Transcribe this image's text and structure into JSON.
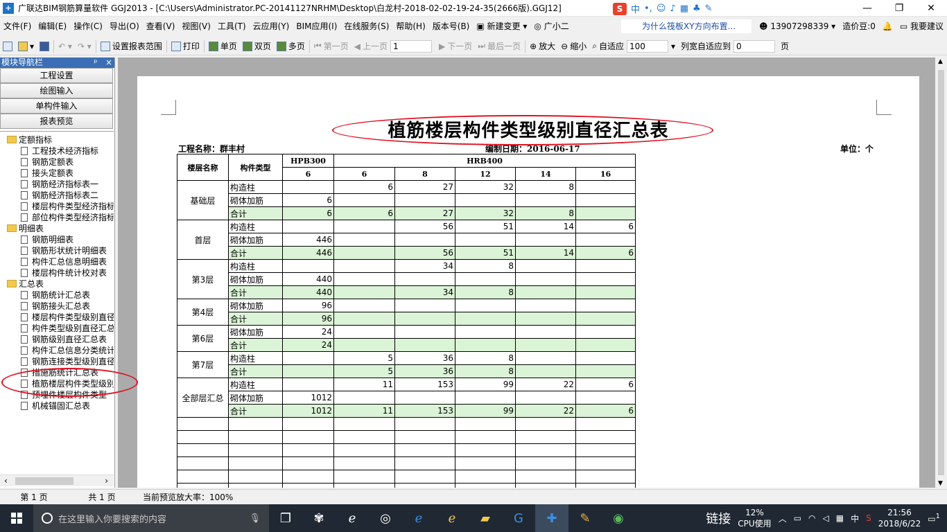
{
  "window": {
    "title": "广联达BIM钢筋算量软件 GGJ2013 - [C:\\Users\\Administrator.PC-20141127NRHM\\Desktop\\白龙村-2018-02-02-19-24-35(2666版).GGJ12]",
    "app_icon": "+",
    "ime": {
      "logo": "S",
      "mode": "中"
    }
  },
  "menu": {
    "items": [
      "文件(F)",
      "编辑(E)",
      "操作(C)",
      "导出(O)",
      "查看(V)",
      "视图(V)",
      "工具(T)",
      "云应用(Y)",
      "BIM应用(I)",
      "在线服务(S)",
      "帮助(H)",
      "版本号(B)"
    ],
    "new_change": "新建变更",
    "guide": "广小二",
    "notice": "为什么筏板XY方向布置...",
    "phone": "13907298339",
    "cost_bean": "造价豆:0",
    "suggest": "我要建议"
  },
  "toolbar": {
    "set_range": "设置报表范围",
    "print": "打印",
    "single_page": "单页",
    "double_page": "双页",
    "multi_page": "多页",
    "first_page": "第一页",
    "prev_page": "上一页",
    "page_value": "1",
    "next_page": "下一页",
    "last_page": "最后一页",
    "zoom_in": "放大",
    "zoom_out": "缩小",
    "fit": "自适应",
    "zoom_value": "100",
    "col_fit": "列宽自适应到",
    "col_fit_value": "0",
    "page_unit": "页"
  },
  "sidebar": {
    "title": "模块导航栏",
    "pin": "ᵖ",
    "close": "×",
    "nav_buttons": [
      "工程设置",
      "绘图输入",
      "单构件输入",
      "报表预览"
    ],
    "tree": [
      {
        "label": "定额指标",
        "type": "folder",
        "level": 0
      },
      {
        "label": "工程技术经济指标",
        "type": "page",
        "level": 1
      },
      {
        "label": "钢筋定额表",
        "type": "page",
        "level": 1
      },
      {
        "label": "接头定额表",
        "type": "page",
        "level": 1
      },
      {
        "label": "钢筋经济指标表一",
        "type": "page",
        "level": 1
      },
      {
        "label": "钢筋经济指标表二",
        "type": "page",
        "level": 1
      },
      {
        "label": "楼层构件类型经济指标",
        "type": "page",
        "level": 1
      },
      {
        "label": "部位构件类型经济指标",
        "type": "page",
        "level": 1
      },
      {
        "label": "明细表",
        "type": "folder",
        "level": 0
      },
      {
        "label": "钢筋明细表",
        "type": "page",
        "level": 1
      },
      {
        "label": "钢筋形状统计明细表",
        "type": "page",
        "level": 1
      },
      {
        "label": "构件汇总信息明细表",
        "type": "page",
        "level": 1
      },
      {
        "label": "楼层构件统计校对表",
        "type": "page",
        "level": 1
      },
      {
        "label": "汇总表",
        "type": "folder",
        "level": 0
      },
      {
        "label": "钢筋统计汇总表",
        "type": "page",
        "level": 1
      },
      {
        "label": "钢筋接头汇总表",
        "type": "page",
        "level": 1
      },
      {
        "label": "楼层构件类型级别直径",
        "type": "page",
        "level": 1
      },
      {
        "label": "构件类型级别直径汇总",
        "type": "page",
        "level": 1
      },
      {
        "label": "钢筋级别直径汇总表",
        "type": "page",
        "level": 1
      },
      {
        "label": "构件汇总信息分类统计",
        "type": "page",
        "level": 1
      },
      {
        "label": "钢筋连接类型级别直径",
        "type": "page",
        "level": 1
      },
      {
        "label": "措施筋统计汇总表",
        "type": "page",
        "level": 1
      },
      {
        "label": "植筋楼层构件类型级别",
        "type": "page",
        "level": 1,
        "selected": true
      },
      {
        "label": "预埋件楼层构件类型",
        "type": "page",
        "level": 1
      },
      {
        "label": "机械锚固汇总表",
        "type": "page",
        "level": 1
      }
    ]
  },
  "report": {
    "title": "植筋楼层构件类型级别直径汇总表",
    "project_label": "工程名称：群丰村",
    "date_label": "编制日期：2016-06-17",
    "unit_label": "单位：个",
    "headers": {
      "floor": "楼层名称",
      "type": "构件类型",
      "grade1": "HPB300",
      "grade2": "HRB400",
      "diameters": [
        "6",
        "6",
        "8",
        "12",
        "14",
        "16"
      ]
    },
    "groups": [
      {
        "floor": "基础层",
        "rows": [
          {
            "type": "构造柱",
            "values": [
              "",
              "6",
              "27",
              "32",
              "8",
              ""
            ]
          },
          {
            "type": "砌体加筋",
            "values": [
              "6",
              "",
              "",
              "",
              "",
              ""
            ]
          },
          {
            "type": "合计",
            "values": [
              "6",
              "6",
              "27",
              "32",
              "8",
              ""
            ]
          }
        ]
      },
      {
        "floor": "首层",
        "rows": [
          {
            "type": "构造柱",
            "values": [
              "",
              "",
              "56",
              "51",
              "14",
              "6"
            ]
          },
          {
            "type": "砌体加筋",
            "values": [
              "446",
              "",
              "",
              "",
              "",
              ""
            ]
          },
          {
            "type": "合计",
            "values": [
              "446",
              "",
              "56",
              "51",
              "14",
              "6"
            ]
          }
        ]
      },
      {
        "floor": "第3层",
        "rows": [
          {
            "type": "构造柱",
            "values": [
              "",
              "",
              "34",
              "8",
              "",
              ""
            ]
          },
          {
            "type": "砌体加筋",
            "values": [
              "440",
              "",
              "",
              "",
              "",
              ""
            ]
          },
          {
            "type": "合计",
            "values": [
              "440",
              "",
              "34",
              "8",
              "",
              ""
            ]
          }
        ]
      },
      {
        "floor": "第4层",
        "rows": [
          {
            "type": "砌体加筋",
            "values": [
              "96",
              "",
              "",
              "",
              "",
              ""
            ]
          },
          {
            "type": "合计",
            "values": [
              "96",
              "",
              "",
              "",
              "",
              ""
            ]
          }
        ]
      },
      {
        "floor": "第6层",
        "rows": [
          {
            "type": "砌体加筋",
            "values": [
              "24",
              "",
              "",
              "",
              "",
              ""
            ]
          },
          {
            "type": "合计",
            "values": [
              "24",
              "",
              "",
              "",
              "",
              ""
            ]
          }
        ]
      },
      {
        "floor": "第7层",
        "rows": [
          {
            "type": "构造柱",
            "values": [
              "",
              "5",
              "36",
              "8",
              "",
              ""
            ]
          },
          {
            "type": "合计",
            "values": [
              "",
              "5",
              "36",
              "8",
              "",
              ""
            ]
          }
        ]
      },
      {
        "floor": "全部层汇总",
        "rows": [
          {
            "type": "构造柱",
            "values": [
              "",
              "11",
              "153",
              "99",
              "22",
              "6"
            ]
          },
          {
            "type": "砌体加筋",
            "values": [
              "1012",
              "",
              "",
              "",
              "",
              ""
            ]
          },
          {
            "type": "合计",
            "values": [
              "1012",
              "11",
              "153",
              "99",
              "22",
              "6"
            ]
          }
        ]
      }
    ]
  },
  "status": {
    "page": "第 1 页",
    "total": "共 1 页",
    "zoom": "当前预览放大率：100%"
  },
  "taskbar": {
    "search_placeholder": "在这里输入你要搜索的内容",
    "cpu_percent": "12%",
    "cpu_label": "CPU使用",
    "link": "链接",
    "lang": "中",
    "time": "21:56",
    "date": "2018/6/22",
    "notif_count": "1"
  },
  "colors": {
    "total_row": "#dbf3d6",
    "highlight_ellipse": "#e01020",
    "sidebar_header": "#3b6fb5"
  }
}
